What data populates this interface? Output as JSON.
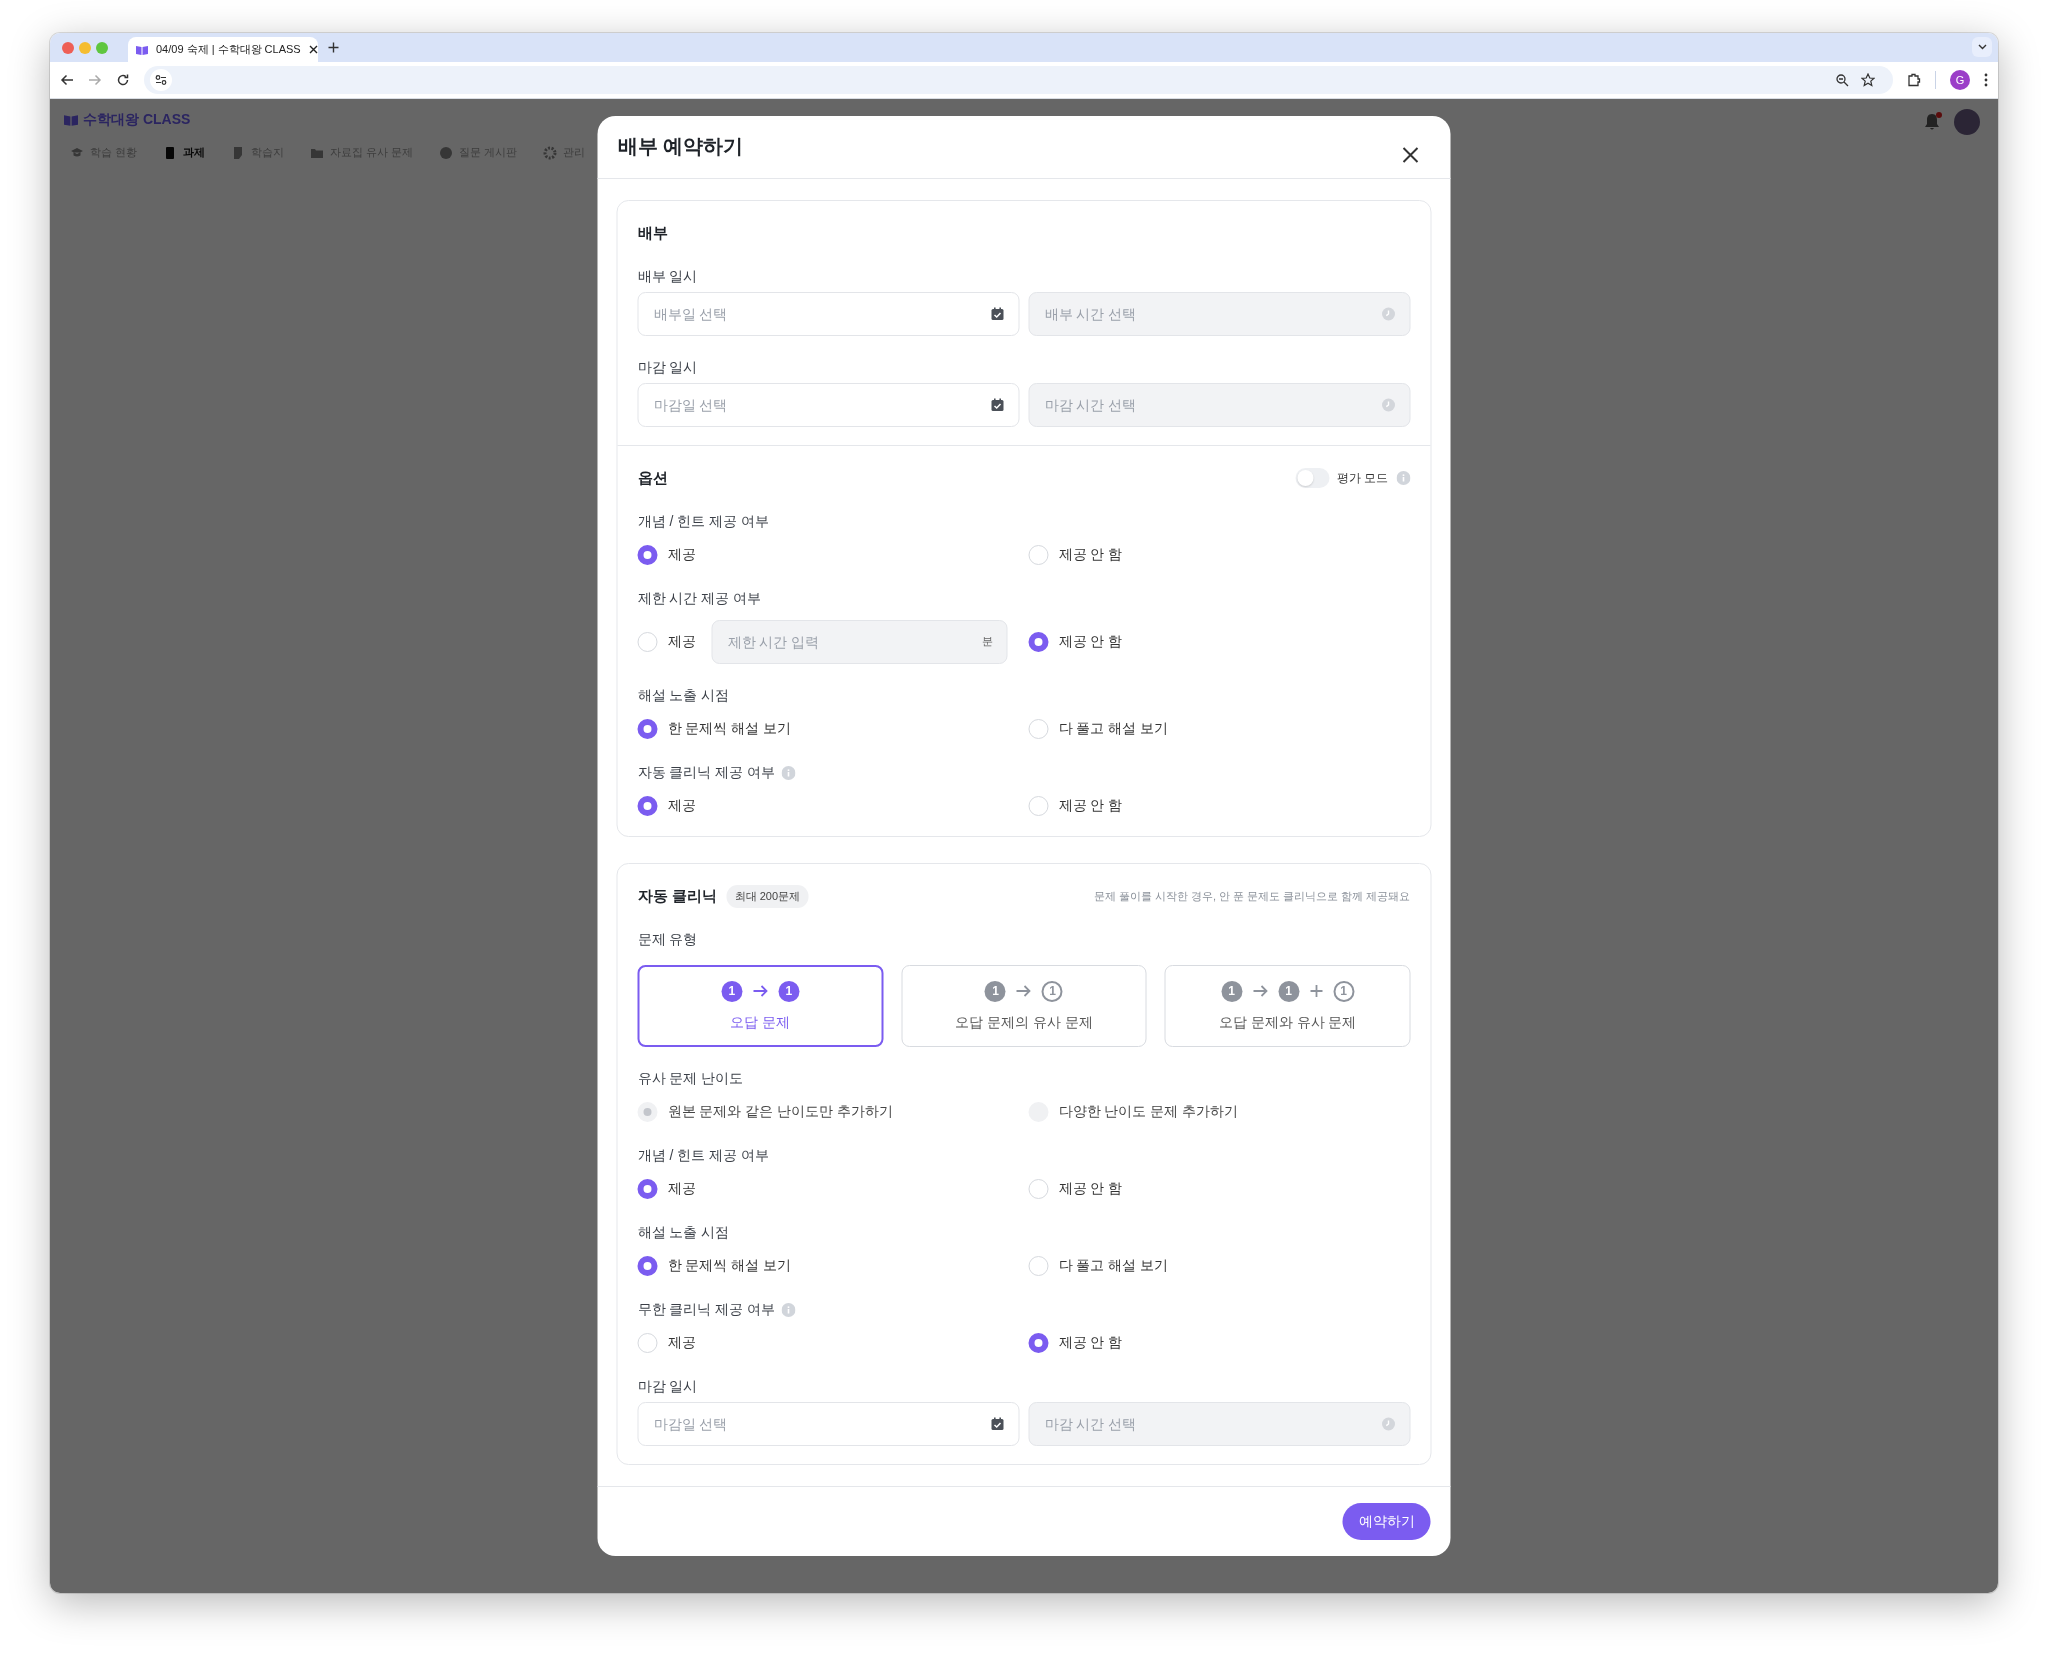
{
  "browser": {
    "tab_title": "04/09 숙제 | 수학대왕 CLASS",
    "profile_initial": "G"
  },
  "app": {
    "logo": "수학대왕 CLASS",
    "notification_unread": true,
    "nav": [
      {
        "label": "학습 현황",
        "selected": false
      },
      {
        "label": "과제",
        "selected": true
      },
      {
        "label": "학습지",
        "selected": false
      },
      {
        "label": "자료집 유사 문제",
        "selected": false
      },
      {
        "label": "질문 게시판",
        "selected": false
      },
      {
        "label": "관리",
        "selected": false
      }
    ]
  },
  "modal": {
    "title": "배부 예약하기",
    "submit": "예약하기",
    "cards": [
      {
        "parts": [
          {
            "title": "배부",
            "rows": [
              {
                "kind": "datetime",
                "label": "배부 일시",
                "date_placeholder": "배부일 선택",
                "time_placeholder": "배부 시간 선택",
                "time_disabled": true
              },
              {
                "kind": "datetime",
                "label": "마감 일시",
                "date_placeholder": "마감일 선택",
                "time_placeholder": "마감 시간 선택",
                "time_disabled": true
              }
            ]
          },
          {
            "title": "옵션",
            "toggle": {
              "label": "평가 모드",
              "on": false,
              "info": true
            },
            "rows": [
              {
                "kind": "radio",
                "label": "개념 / 힌트 제공 여부",
                "disabled": false,
                "options": [
                  {
                    "label": "제공",
                    "selected": true
                  },
                  {
                    "label": "제공 안 함",
                    "selected": false
                  }
                ]
              },
              {
                "kind": "radio",
                "label": "제한 시간 제공 여부",
                "disabled": false,
                "options": [
                  {
                    "label": "제공",
                    "selected": false,
                    "input": {
                      "placeholder": "제한 시간 입력",
                      "unit": "분"
                    }
                  },
                  {
                    "label": "제공 안 함",
                    "selected": true
                  }
                ]
              },
              {
                "kind": "radio",
                "label": "해설 노출 시점",
                "disabled": false,
                "options": [
                  {
                    "label": "한 문제씩 해설 보기",
                    "selected": true
                  },
                  {
                    "label": "다 풀고 해설 보기",
                    "selected": false
                  }
                ]
              },
              {
                "kind": "radio",
                "label": "자동 클리닉 제공 여부",
                "info": true,
                "disabled": false,
                "options": [
                  {
                    "label": "제공",
                    "selected": true
                  },
                  {
                    "label": "제공 안 함",
                    "selected": false
                  }
                ]
              }
            ]
          }
        ]
      },
      {
        "parts": [
          {
            "title": "자동 클리닉",
            "badge": "최대 200문제",
            "note": "문제 풀이를 시작한 경우, 안 푼 문제도 클리닉으로 함께 제공돼요",
            "rows": [
              {
                "kind": "types",
                "label": "문제 유형",
                "options": [
                  {
                    "label": "오답 문제",
                    "selected": true,
                    "symbols": [
                      {
                        "kind": "filled",
                        "text": "1"
                      },
                      {
                        "kind": "arrow"
                      },
                      {
                        "kind": "filled",
                        "text": "1"
                      }
                    ]
                  },
                  {
                    "label": "오답 문제의 유사 문제",
                    "selected": false,
                    "symbols": [
                      {
                        "kind": "filled",
                        "text": "1"
                      },
                      {
                        "kind": "arrow"
                      },
                      {
                        "kind": "outline",
                        "text": "1"
                      }
                    ]
                  },
                  {
                    "label": "오답 문제와 유사 문제",
                    "selected": false,
                    "symbols": [
                      {
                        "kind": "filled",
                        "text": "1"
                      },
                      {
                        "kind": "arrow"
                      },
                      {
                        "kind": "filled",
                        "text": "1"
                      },
                      {
                        "kind": "plus"
                      },
                      {
                        "kind": "outline",
                        "text": "1"
                      }
                    ]
                  }
                ]
              },
              {
                "kind": "radio",
                "label": "유사 문제 난이도",
                "disabled": true,
                "options": [
                  {
                    "label": "원본 문제와 같은 난이도만 추가하기",
                    "selected": true
                  },
                  {
                    "label": "다양한 난이도 문제 추가하기",
                    "selected": false
                  }
                ]
              },
              {
                "kind": "radio",
                "label": "개념 / 힌트 제공 여부",
                "disabled": false,
                "options": [
                  {
                    "label": "제공",
                    "selected": true
                  },
                  {
                    "label": "제공 안 함",
                    "selected": false
                  }
                ]
              },
              {
                "kind": "radio",
                "label": "해설 노출 시점",
                "disabled": false,
                "options": [
                  {
                    "label": "한 문제씩 해설 보기",
                    "selected": true
                  },
                  {
                    "label": "다 풀고 해설 보기",
                    "selected": false
                  }
                ]
              },
              {
                "kind": "radio",
                "label": "무한 클리닉 제공 여부",
                "info": true,
                "disabled": false,
                "options": [
                  {
                    "label": "제공",
                    "selected": false
                  },
                  {
                    "label": "제공 안 함",
                    "selected": true
                  }
                ]
              },
              {
                "kind": "datetime",
                "label": "마감 일시",
                "date_placeholder": "마감일 선택",
                "time_placeholder": "마감 시간 선택",
                "time_disabled": true
              }
            ]
          }
        ]
      }
    ]
  }
}
